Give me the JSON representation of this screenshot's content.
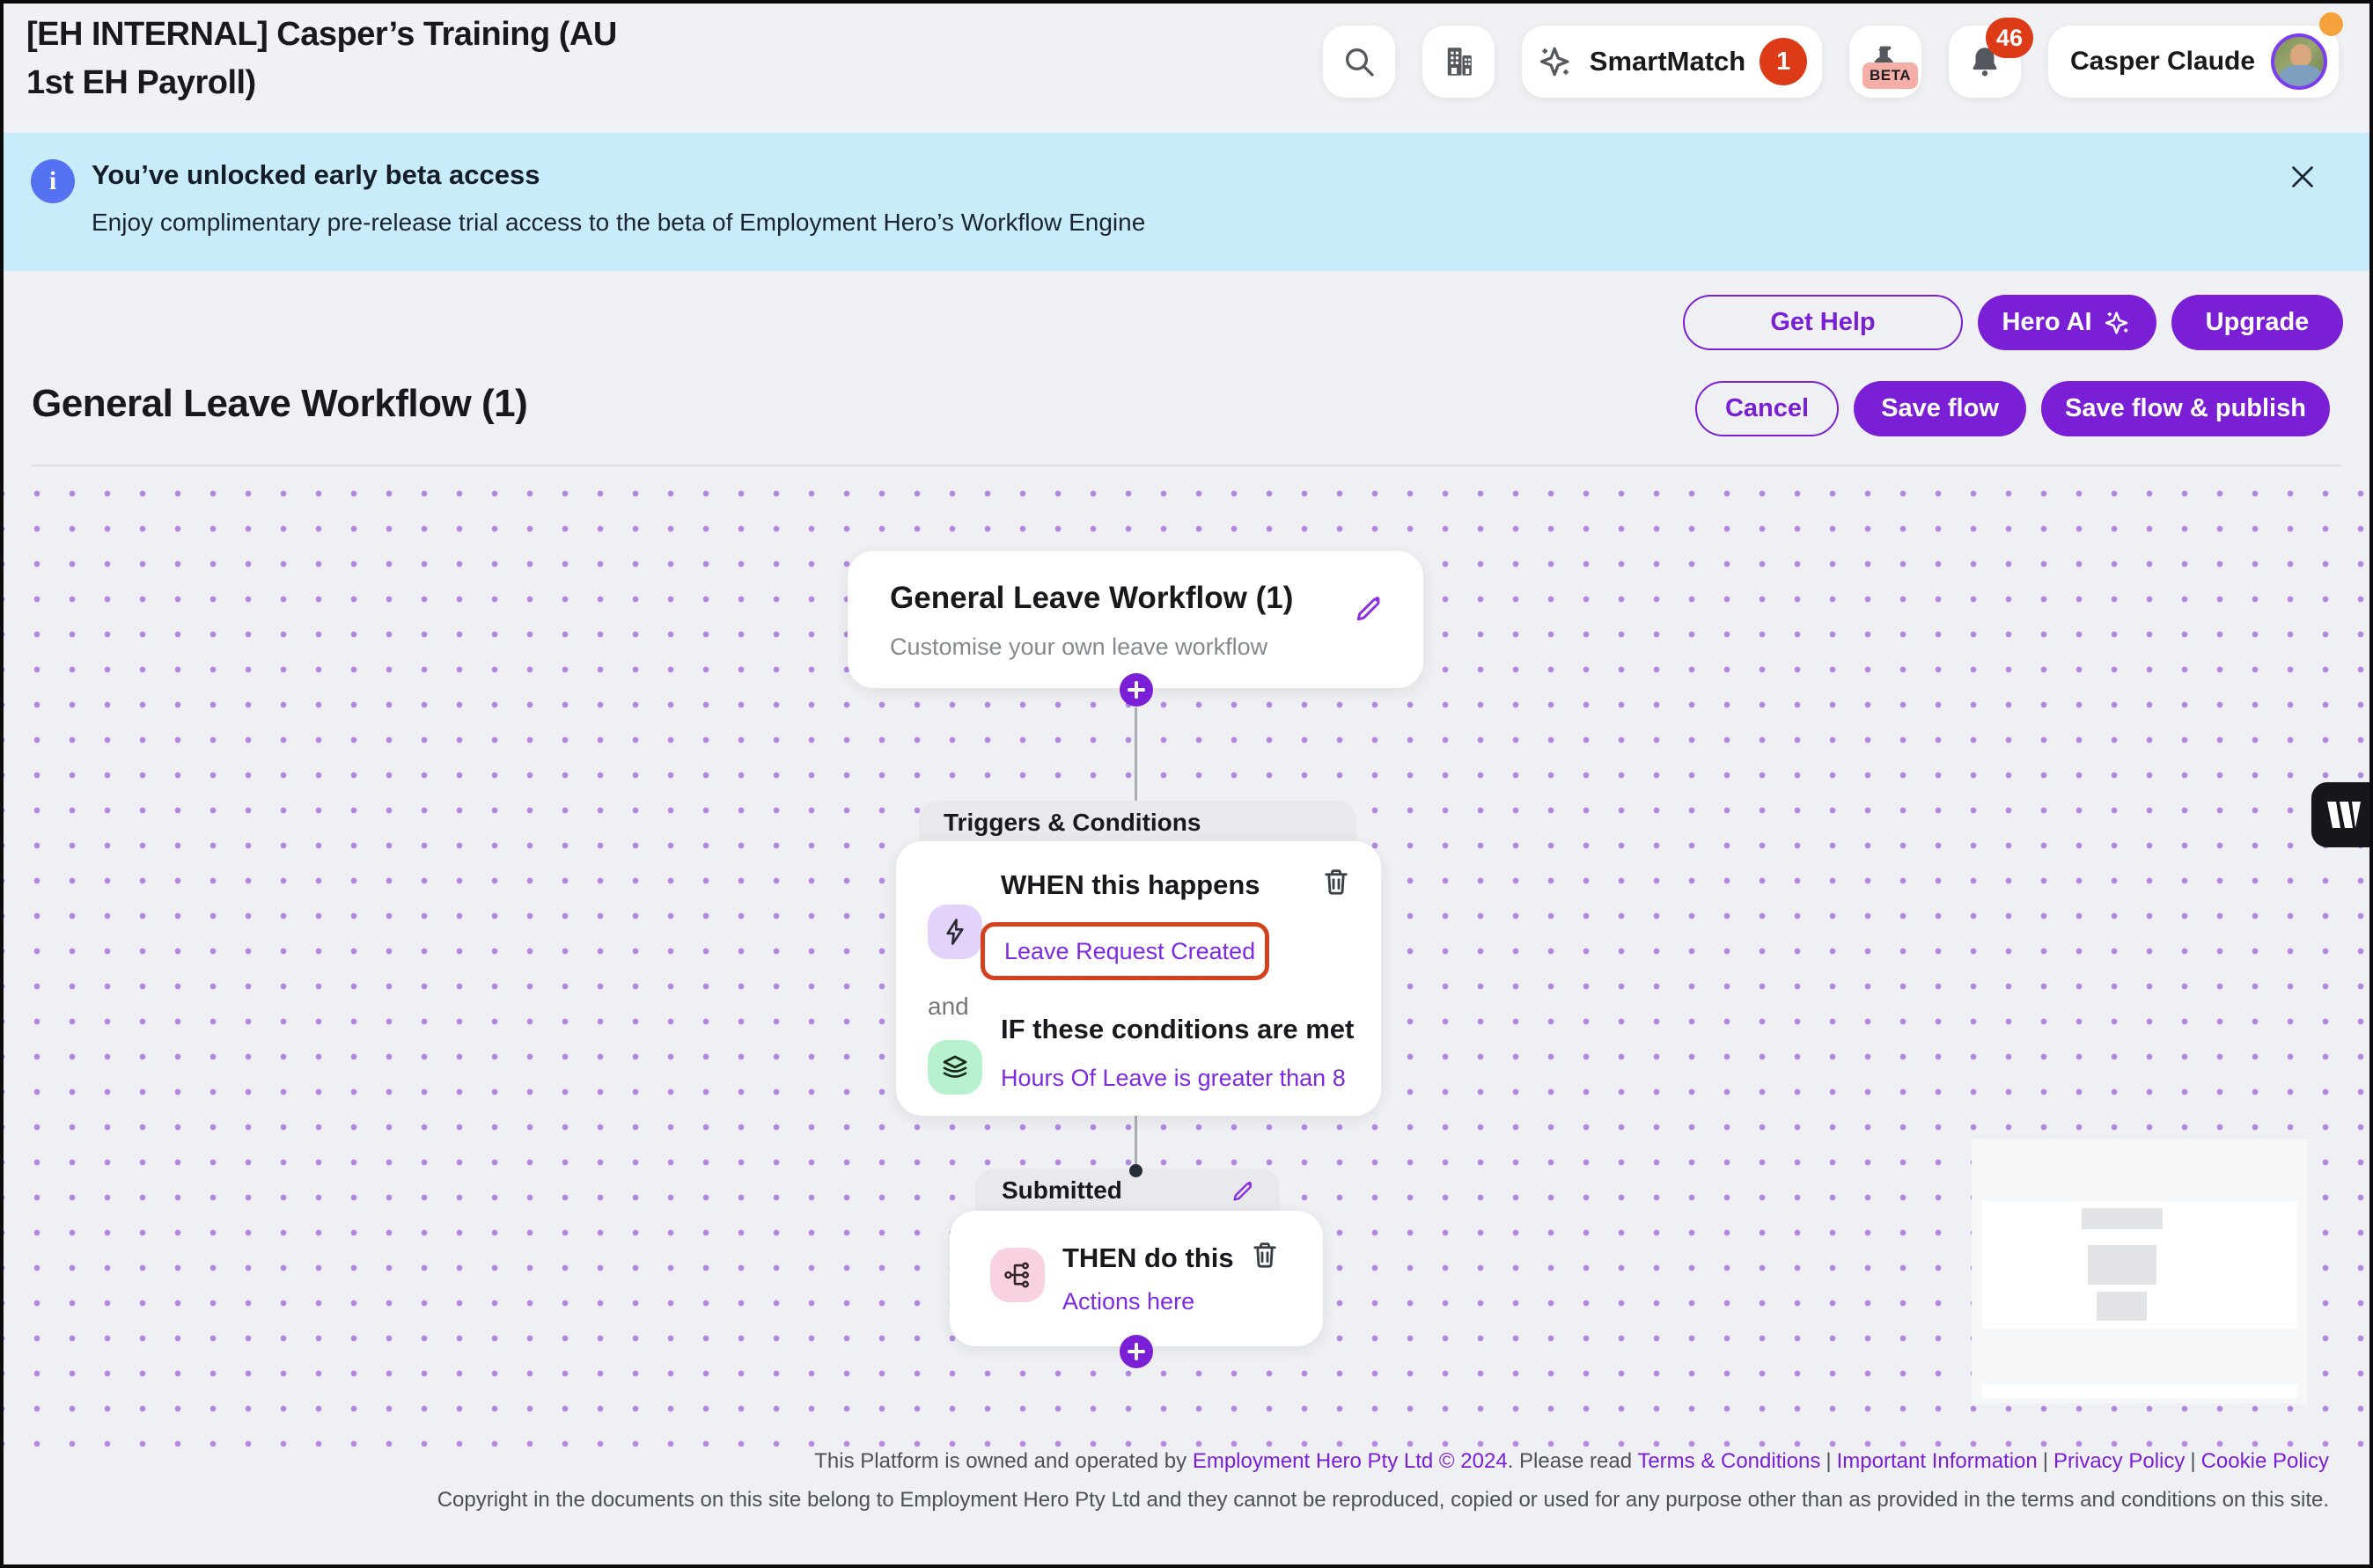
{
  "header": {
    "title": "[EH INTERNAL] Casper’s Training (AU 1st EH Payroll)",
    "smartmatch_label": "SmartMatch",
    "smartmatch_badge": "1",
    "beta_label": "BETA",
    "notification_count": "46",
    "user_name": "Casper Claude"
  },
  "banner": {
    "title": "You’ve unlocked early beta access",
    "subtitle": "Enjoy complimentary pre-release trial access to the beta of Employment Hero’s Workflow Engine"
  },
  "toolbar": {
    "get_help": "Get Help",
    "hero_ai": "Hero AI",
    "upgrade": "Upgrade",
    "cancel": "Cancel",
    "save_flow": "Save flow",
    "save_flow_publish": "Save flow & publish"
  },
  "page": {
    "title": "General Leave Workflow (1)"
  },
  "workflow": {
    "card_title": "General Leave Workflow (1)",
    "card_subtitle": "Customise your own leave workflow",
    "triggers_header": "Triggers & Conditions",
    "when_label": "WHEN this happens",
    "trigger_value": "Leave Request Created",
    "and_label": "and",
    "if_label": "IF these conditions are met",
    "condition_value": "Hours Of Leave is greater than 8",
    "stage_label": "Submitted",
    "then_label": "THEN do this",
    "actions_value": "Actions here"
  },
  "footer": {
    "line1_prefix": "This Platform is owned and operated by ",
    "line1_company": "Employment Hero Pty Ltd © 2024",
    "line1_mid": ". Please read ",
    "separator": "|",
    "links": [
      "Terms & Conditions",
      "Important Information",
      "Privacy Policy",
      "Cookie Policy"
    ],
    "line2": "Copyright in the documents on this site belong to Employment Hero Pty Ltd and they cannot be reproduced, copied or used for any purpose other than as provided in the terms and conditions on this site."
  },
  "colors": {
    "accent_purple": "#7a1fd6",
    "link_purple": "#7d2ae0",
    "highlight_red": "#d6411d",
    "badge_red": "#dd3a18",
    "banner_blue": "#c9ecfb",
    "beta_pink": "#f4aea6",
    "icon_bg_purple": "#e3d2f9",
    "icon_bg_green": "#b7f1cd",
    "icon_bg_pink": "#f9d2e2"
  }
}
